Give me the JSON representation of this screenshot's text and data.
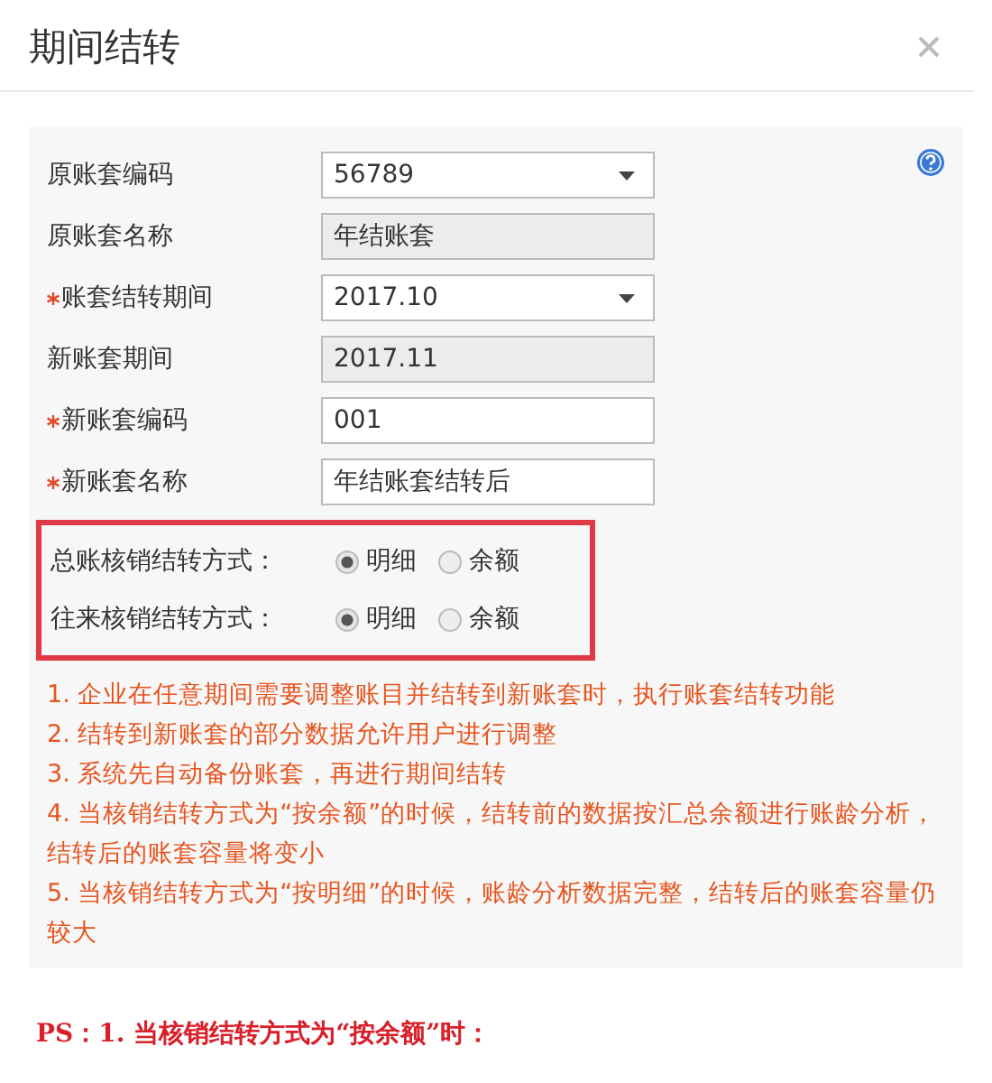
{
  "window": {
    "title": "期间结转"
  },
  "fields": [
    {
      "label": "原账套编码",
      "required": false,
      "kind": "select",
      "value": "56789"
    },
    {
      "label": "原账套名称",
      "required": false,
      "kind": "readonly",
      "value": "年结账套"
    },
    {
      "label": "账套结转期间",
      "required": true,
      "kind": "select",
      "value": "2017.10"
    },
    {
      "label": "新账套期间",
      "required": false,
      "kind": "readonly",
      "value": "2017.11"
    },
    {
      "label": "新账套编码",
      "required": true,
      "kind": "input",
      "value": "001"
    },
    {
      "label": "新账套名称",
      "required": true,
      "kind": "input",
      "value": "年结账套结转后"
    }
  ],
  "radio_groups": [
    {
      "label": "总账核销结转方式：",
      "options": [
        {
          "label": "明细",
          "selected": true
        },
        {
          "label": "余额",
          "selected": false
        }
      ]
    },
    {
      "label": "往来核销结转方式：",
      "options": [
        {
          "label": "明细",
          "selected": true
        },
        {
          "label": "余额",
          "selected": false
        }
      ]
    }
  ],
  "notes": [
    "1. 企业在任意期间需要调整账目并结转到新账套时，执行账套结转功能",
    "2. 结转到新账套的部分数据允许用户进行调整",
    "3. 系统先自动备份账套，再进行期间结转",
    "4. 当核销结转方式为“按余额”的时候，结转前的数据按汇总余额进行账龄分析，结转后的账套容量将变小",
    "5. 当核销结转方式为“按明细”的时候，账龄分析数据完整，结转后的账套容量仍较大"
  ],
  "ps": "PS：1. 当核销结转方式为“按余额”时："
}
